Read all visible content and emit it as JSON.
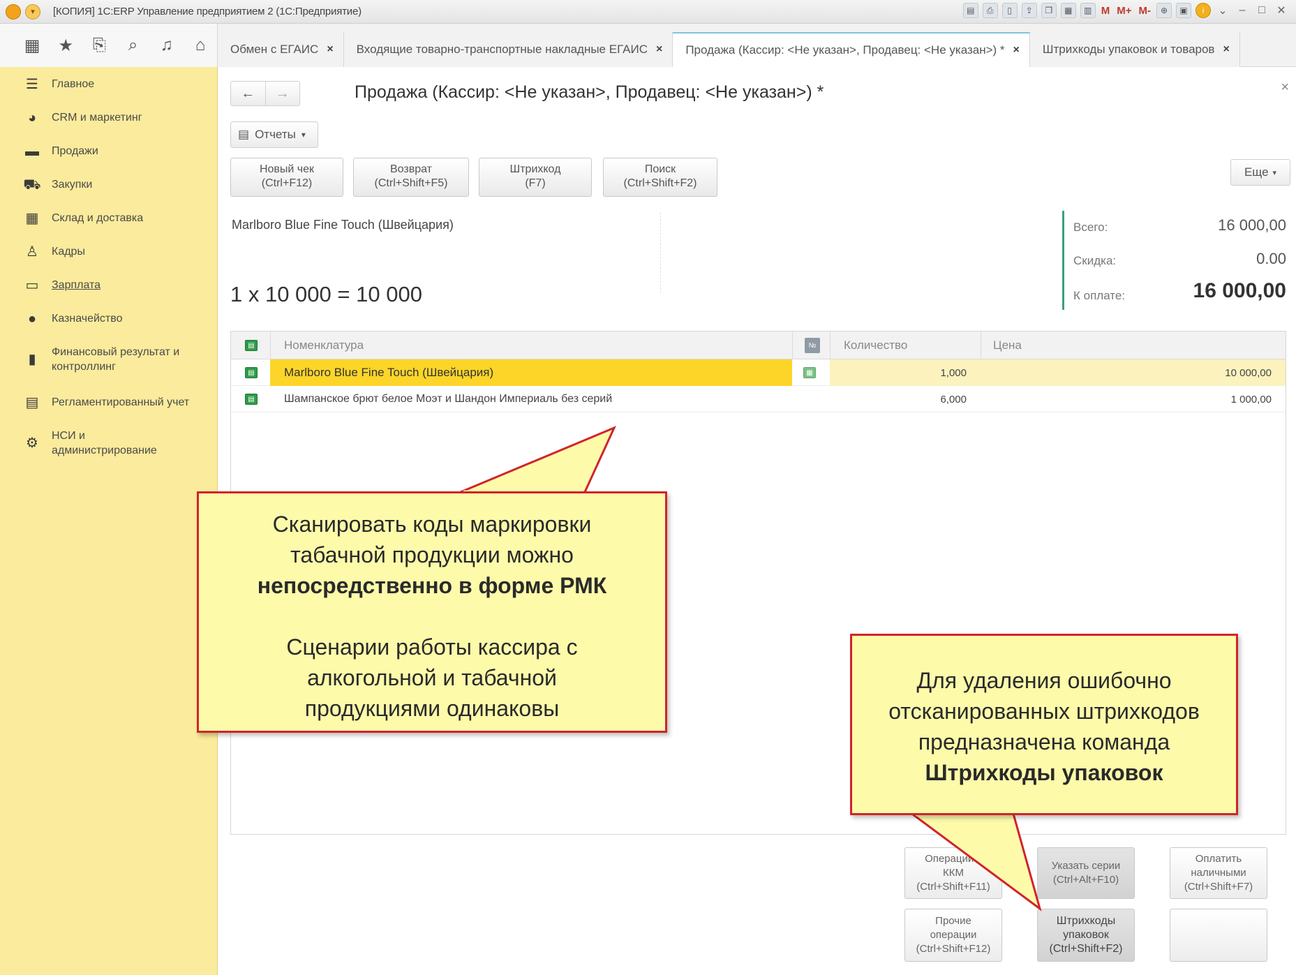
{
  "window": {
    "title": "[КОПИЯ] 1C:ERP Управление предприятием 2  (1С:Предприятие)",
    "tools": [
      "M",
      "M+",
      "M-"
    ]
  },
  "tabs": [
    {
      "label": "Обмен с ЕГАИС",
      "active": false
    },
    {
      "label": "Входящие товарно-транспортные накладные ЕГАИС",
      "active": false
    },
    {
      "label": "Продажа (Кассир: <Не указан>, Продавец: <Не указан>) *",
      "active": true
    },
    {
      "label": "Штрихкоды упаковок и товаров",
      "active": false
    }
  ],
  "sidebar": {
    "items": [
      {
        "label": "Главное",
        "icon": "menu-icon"
      },
      {
        "label": "CRM и маркетинг",
        "icon": "pie-chart-icon"
      },
      {
        "label": "Продажи",
        "icon": "bag-icon"
      },
      {
        "label": "Закупки",
        "icon": "cart-icon"
      },
      {
        "label": "Склад и доставка",
        "icon": "warehouse-icon"
      },
      {
        "label": "Кадры",
        "icon": "person-icon"
      },
      {
        "label": "Зарплата",
        "icon": "wallet-icon"
      },
      {
        "label": "Казначейство",
        "icon": "coins-icon"
      },
      {
        "label": "Финансовый результат и контроллинг",
        "icon": "bar-chart-icon"
      },
      {
        "label": "Регламентированный учет",
        "icon": "ledger-icon"
      },
      {
        "label": "НСИ и администрирование",
        "icon": "gear-icon"
      }
    ]
  },
  "form": {
    "title": "Продажа (Кассир: <Не указан>, Продавец: <Не указан>) *",
    "reports_label": "Отчеты",
    "buttons": {
      "new_check": [
        "Новый чек",
        "(Ctrl+F12)"
      ],
      "return": [
        "Возврат",
        "(Ctrl+Shift+F5)"
      ],
      "barcode": [
        "Штрихкод",
        "(F7)"
      ],
      "search": [
        "Поиск",
        "(Ctrl+Shift+F2)"
      ]
    },
    "more_label": "Еще",
    "current_product": "Marlboro Blue Fine Touch (Швейцария)",
    "calc_line": "1 x 10 000 = 10 000",
    "totals": {
      "total_label": "Всего:",
      "total_value": "16 000,00",
      "discount_label": "Скидка:",
      "discount_value": "0.00",
      "pay_label": "К оплате:",
      "pay_value": "16 000,00"
    }
  },
  "table": {
    "headers": {
      "name": "Номенклатура",
      "num": "№",
      "qty": "Количество",
      "price": "Цена"
    },
    "rows": [
      {
        "name": "Marlboro Blue Fine Touch (Швейцария)",
        "qty": "1,000",
        "price": "10 000,00"
      },
      {
        "name": "Шампанское брют белое Моэт и Шандон Империаль без серий",
        "qty": "6,000",
        "price": "1 000,00"
      }
    ]
  },
  "bottom_buttons": {
    "kkm": [
      "Операции с",
      "ККМ",
      "(Ctrl+Shift+F11)"
    ],
    "series": [
      "Указать серии",
      "(Ctrl+Alt+F10)"
    ],
    "pay_cash": [
      "Оплатить",
      "наличными",
      "(Ctrl+Shift+F7)"
    ],
    "other_ops": [
      "Прочие",
      "операции",
      "(Ctrl+Shift+F12)"
    ],
    "pack_barcodes": [
      "Штрихкоды",
      "упаковок",
      "(Ctrl+Shift+F2)"
    ]
  },
  "callouts": {
    "left": {
      "line1": "Сканировать коды маркировки",
      "line2": "табачной продукции можно",
      "line3_bold": "непосредственно в форме РМК",
      "line4": "Сценарии работы кассира с",
      "line5": "алкогольной и табачной",
      "line6": "продукциями одинаковы"
    },
    "right": {
      "line1": "Для удаления ошибочно",
      "line2": "отсканированных штрихкодов",
      "line3": "предназначена команда",
      "line4_bold": "Штрихкоды упаковок"
    }
  },
  "colors": {
    "sidebar_bg": "#fbeb9c",
    "row_highlight": "#fcd528",
    "callout_bg": "#fdfbaa",
    "callout_border": "#d0242b",
    "accent_green": "#3aa37a"
  }
}
